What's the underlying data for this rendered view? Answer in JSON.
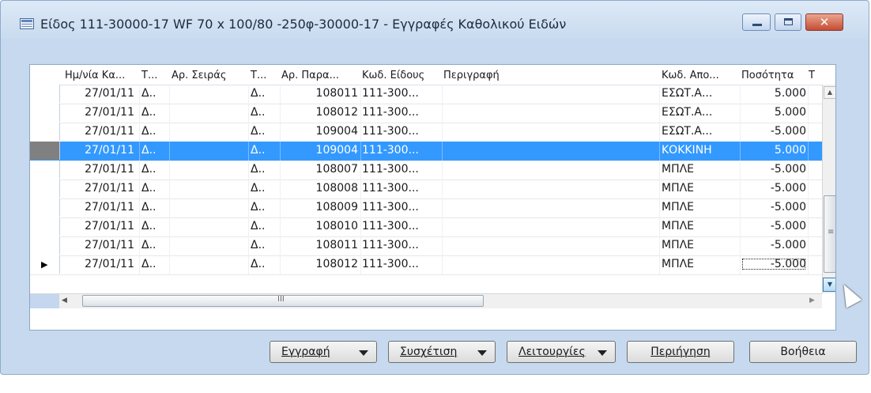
{
  "window": {
    "title": "Είδος 111-30000-17 WF 70 x 100/80 -250φ-30000-17 - Εγγραφές Καθολικού Ειδών",
    "minimize": "–",
    "maximize": "□",
    "close": "✕"
  },
  "grid": {
    "columns": [
      "Ημ/νία Κα...",
      "Τ...",
      "Αρ. Σειράς",
      "Τ...",
      "Αρ. Παρα...",
      "Κωδ. Είδους",
      "Περιγραφή",
      "Κωδ. Απο...",
      "Ποσότητα",
      "Τ"
    ],
    "rows": [
      {
        "date": "27/01/11",
        "t1": "Δ..",
        "serial": "",
        "t2": "Δ..",
        "doc": "108011",
        "item": "111-300...",
        "desc": "",
        "loc": "ΕΣΩΤ.Α...",
        "qty": "5.000",
        "marker": ""
      },
      {
        "date": "27/01/11",
        "t1": "Δ..",
        "serial": "",
        "t2": "Δ..",
        "doc": "108012",
        "item": "111-300...",
        "desc": "",
        "loc": "ΕΣΩΤ.Α...",
        "qty": "5.000",
        "marker": ""
      },
      {
        "date": "27/01/11",
        "t1": "Δ..",
        "serial": "",
        "t2": "Δ..",
        "doc": "109004",
        "item": "111-300...",
        "desc": "",
        "loc": "ΕΣΩΤ.Α...",
        "qty": "-5.000",
        "marker": ""
      },
      {
        "date": "27/01/11",
        "t1": "Δ..",
        "serial": "",
        "t2": "Δ..",
        "doc": "109004",
        "item": "111-300...",
        "desc": "",
        "loc": "ΚΟΚΚΙΝΗ",
        "qty": "5.000",
        "marker": ""
      },
      {
        "date": "27/01/11",
        "t1": "Δ..",
        "serial": "",
        "t2": "Δ..",
        "doc": "108007",
        "item": "111-300...",
        "desc": "",
        "loc": "ΜΠΛΕ",
        "qty": "-5.000",
        "marker": ""
      },
      {
        "date": "27/01/11",
        "t1": "Δ..",
        "serial": "",
        "t2": "Δ..",
        "doc": "108008",
        "item": "111-300...",
        "desc": "",
        "loc": "ΜΠΛΕ",
        "qty": "-5.000",
        "marker": ""
      },
      {
        "date": "27/01/11",
        "t1": "Δ..",
        "serial": "",
        "t2": "Δ..",
        "doc": "108009",
        "item": "111-300...",
        "desc": "",
        "loc": "ΜΠΛΕ",
        "qty": "-5.000",
        "marker": ""
      },
      {
        "date": "27/01/11",
        "t1": "Δ..",
        "serial": "",
        "t2": "Δ..",
        "doc": "108010",
        "item": "111-300...",
        "desc": "",
        "loc": "ΜΠΛΕ",
        "qty": "-5.000",
        "marker": ""
      },
      {
        "date": "27/01/11",
        "t1": "Δ..",
        "serial": "",
        "t2": "Δ..",
        "doc": "108011",
        "item": "111-300...",
        "desc": "",
        "loc": "ΜΠΛΕ",
        "qty": "-5.000",
        "marker": ""
      },
      {
        "date": "27/01/11",
        "t1": "Δ..",
        "serial": "",
        "t2": "Δ..",
        "doc": "108012",
        "item": "111-300...",
        "desc": "",
        "loc": "ΜΠΛΕ",
        "qty": "-5.000",
        "marker": "▶"
      }
    ],
    "selected_row": 3,
    "scrollbar": {
      "up": "▲",
      "down": "▼",
      "grip": "≡",
      "left": "◀",
      "right": "▶",
      "h_grip": "III"
    }
  },
  "buttons": {
    "entry": "Εγγραφή",
    "related": "Συσχέτιση",
    "functions": "Λειτουργίες",
    "navigate": "Περιήγηση",
    "help": "Βοήθεια"
  },
  "colors": {
    "selection": "#3399ff",
    "window_frame": "#c7d9ee",
    "close_button": "#c34d33"
  }
}
